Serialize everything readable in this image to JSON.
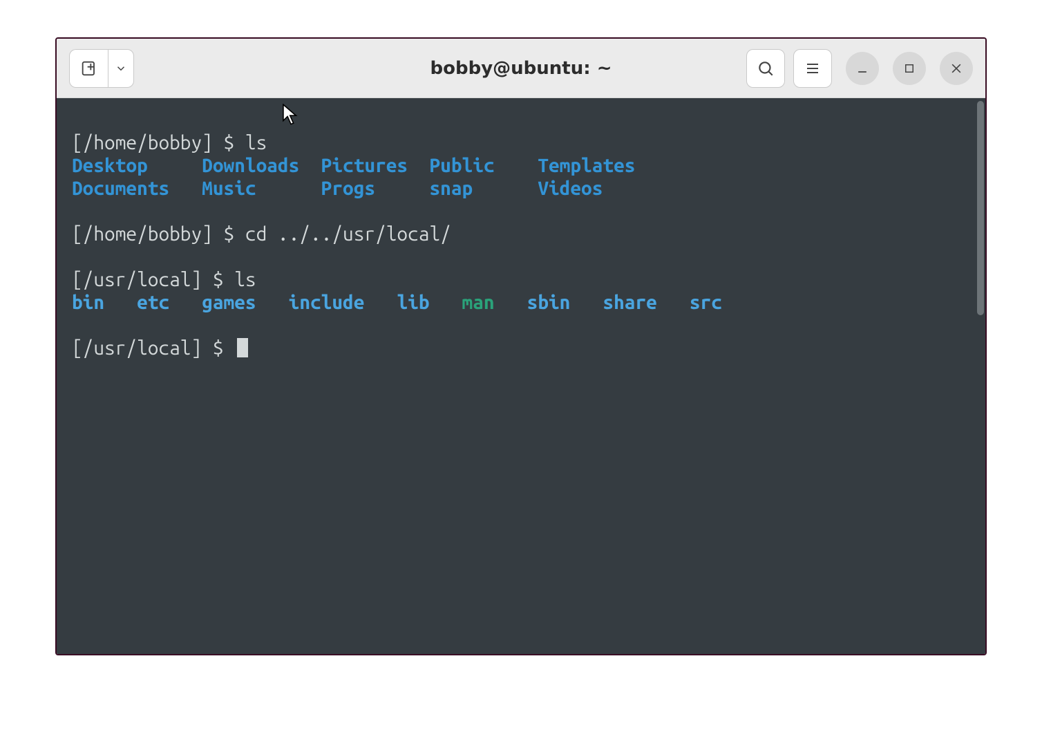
{
  "window": {
    "title": "bobby@ubuntu: ~"
  },
  "terminal": {
    "session": [
      {
        "prompt": "[/home/bobby] $ ",
        "cmd": "ls"
      },
      {
        "ls_row": [
          {
            "name": "Desktop",
            "pad": 5
          },
          {
            "name": "Downloads",
            "pad": 2
          },
          {
            "name": "Pictures",
            "pad": 2
          },
          {
            "name": "Public",
            "pad": 4
          },
          {
            "name": "Templates",
            "pad": 0
          }
        ],
        "class": "dir"
      },
      {
        "ls_row": [
          {
            "name": "Documents",
            "pad": 3
          },
          {
            "name": "Music",
            "pad": 6
          },
          {
            "name": "Progs",
            "pad": 5
          },
          {
            "name": "snap",
            "pad": 6
          },
          {
            "name": "Videos",
            "pad": 0
          }
        ],
        "class": "dir"
      },
      {
        "blank": true
      },
      {
        "prompt": "[/home/bobby] $ ",
        "cmd": "cd ../../usr/local/"
      },
      {
        "blank": true
      },
      {
        "prompt": "[/usr/local] $ ",
        "cmd": "ls"
      },
      {
        "ls_row": [
          {
            "name": "bin",
            "pad": 3,
            "cls": "dir-lt"
          },
          {
            "name": "etc",
            "pad": 3,
            "cls": "dir-lt"
          },
          {
            "name": "games",
            "pad": 3,
            "cls": "dir-lt"
          },
          {
            "name": "include",
            "pad": 3,
            "cls": "dir-lt"
          },
          {
            "name": "lib",
            "pad": 3,
            "cls": "dir-lt"
          },
          {
            "name": "man",
            "pad": 3,
            "cls": "sym"
          },
          {
            "name": "sbin",
            "pad": 3,
            "cls": "dir-lt"
          },
          {
            "name": "share",
            "pad": 3,
            "cls": "dir-lt"
          },
          {
            "name": "src",
            "pad": 0,
            "cls": "dir-lt"
          }
        ]
      },
      {
        "blank": true
      },
      {
        "prompt": "[/usr/local] $ ",
        "cursor": true
      }
    ]
  }
}
